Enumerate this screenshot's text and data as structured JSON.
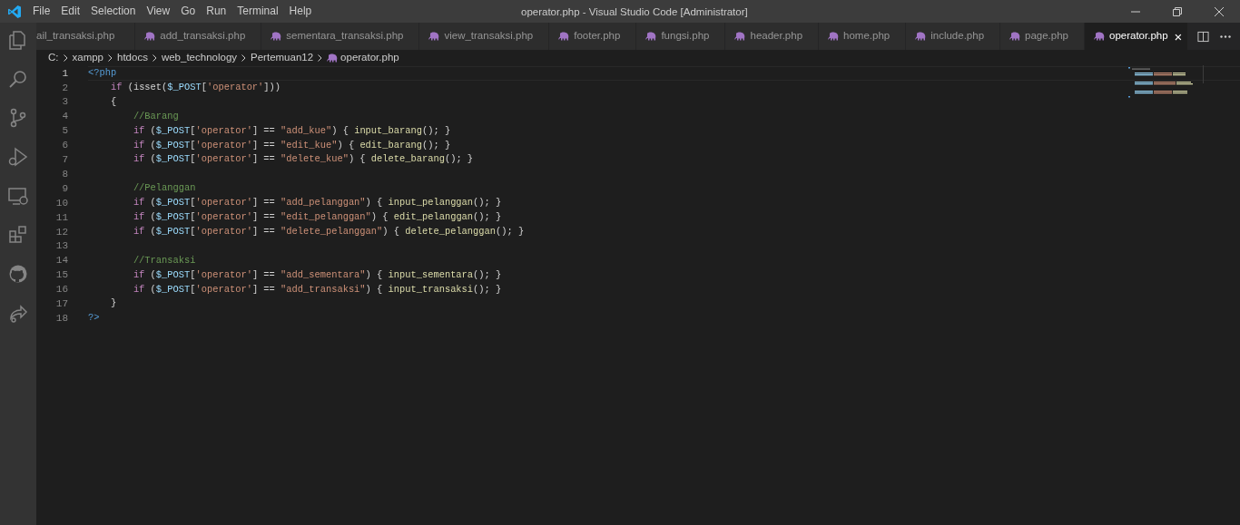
{
  "menu": [
    "File",
    "Edit",
    "Selection",
    "View",
    "Go",
    "Run",
    "Terminal",
    "Help"
  ],
  "window": {
    "title": "operator.php - Visual Studio Code [Administrator]"
  },
  "activity_bar": [
    {
      "kind": "explorer",
      "selected": false
    },
    {
      "kind": "search",
      "selected": false
    },
    {
      "kind": "scm",
      "selected": false
    },
    {
      "kind": "debug",
      "selected": false
    },
    {
      "kind": "remote",
      "selected": false
    },
    {
      "kind": "extensions",
      "selected": false
    },
    {
      "kind": "github",
      "selected": false
    },
    {
      "kind": "share",
      "selected": false
    }
  ],
  "tabs": [
    {
      "label": "ail_transaksi.php",
      "icon": false,
      "selected": false
    },
    {
      "label": "add_transaksi.php",
      "icon": true,
      "selected": false
    },
    {
      "label": "sementara_transaksi.php",
      "icon": true,
      "selected": false
    },
    {
      "label": "view_transaksi.php",
      "icon": true,
      "selected": false
    },
    {
      "label": "footer.php",
      "icon": true,
      "selected": false
    },
    {
      "label": "fungsi.php",
      "icon": true,
      "selected": false
    },
    {
      "label": "header.php",
      "icon": true,
      "selected": false
    },
    {
      "label": "home.php",
      "icon": true,
      "selected": false
    },
    {
      "label": "include.php",
      "icon": true,
      "selected": false
    },
    {
      "label": "page.php",
      "icon": true,
      "selected": false
    },
    {
      "label": "operator.php",
      "icon": true,
      "selected": true,
      "close": "×"
    }
  ],
  "breadcrumb": [
    "C:",
    "xampp",
    "htdocs",
    "web_technology",
    "Pertemuan12",
    "operator.php"
  ],
  "editor": {
    "lines": [
      {
        "number": "1",
        "selected": true,
        "tokens": [
          {
            "kind": "tag",
            "text": "<?php"
          }
        ],
        "children": [
          {
            "number": "2",
            "selected": false,
            "tokens": [
              {
                "kind": "kw",
                "text": "if"
              },
              {
                "kind": "punc",
                "text": " (isset("
              },
              {
                "kind": "var",
                "text": "$_POST"
              },
              {
                "kind": "punc",
                "text": "["
              },
              {
                "kind": "str",
                "text": "'operator'"
              },
              {
                "kind": "punc",
                "text": "]))"
              }
            ]
          },
          {
            "number": "3",
            "selected": false,
            "tokens": [
              {
                "kind": "punc",
                "text": "{"
              }
            ],
            "children": [
              {
                "number": "4",
                "selected": false,
                "tokens": [
                  {
                    "kind": "cmt",
                    "text": "//Barang"
                  }
                ]
              },
              {
                "number": "5",
                "selected": false,
                "tokens": [
                  {
                    "kind": "kw",
                    "text": "if"
                  },
                  {
                    "kind": "punc",
                    "text": " ("
                  },
                  {
                    "kind": "var",
                    "text": "$_POST"
                  },
                  {
                    "kind": "punc",
                    "text": "["
                  },
                  {
                    "kind": "str",
                    "text": "'operator'"
                  },
                  {
                    "kind": "punc",
                    "text": "] == "
                  },
                  {
                    "kind": "str",
                    "text": "\"add_kue\""
                  },
                  {
                    "kind": "punc",
                    "text": ") { "
                  },
                  {
                    "kind": "fn",
                    "text": "input_barang"
                  },
                  {
                    "kind": "punc",
                    "text": "(); }"
                  }
                ]
              },
              {
                "number": "6",
                "selected": false,
                "tokens": [
                  {
                    "kind": "kw",
                    "text": "if"
                  },
                  {
                    "kind": "punc",
                    "text": " ("
                  },
                  {
                    "kind": "var",
                    "text": "$_POST"
                  },
                  {
                    "kind": "punc",
                    "text": "["
                  },
                  {
                    "kind": "str",
                    "text": "'operator'"
                  },
                  {
                    "kind": "punc",
                    "text": "] == "
                  },
                  {
                    "kind": "str",
                    "text": "\"edit_kue\""
                  },
                  {
                    "kind": "punc",
                    "text": ") { "
                  },
                  {
                    "kind": "fn",
                    "text": "edit_barang"
                  },
                  {
                    "kind": "punc",
                    "text": "(); }"
                  }
                ]
              },
              {
                "number": "7",
                "selected": false,
                "tokens": [
                  {
                    "kind": "kw",
                    "text": "if"
                  },
                  {
                    "kind": "punc",
                    "text": " ("
                  },
                  {
                    "kind": "var",
                    "text": "$_POST"
                  },
                  {
                    "kind": "punc",
                    "text": "["
                  },
                  {
                    "kind": "str",
                    "text": "'operator'"
                  },
                  {
                    "kind": "punc",
                    "text": "] == "
                  },
                  {
                    "kind": "str",
                    "text": "\"delete_kue\""
                  },
                  {
                    "kind": "punc",
                    "text": ") { "
                  },
                  {
                    "kind": "fn",
                    "text": "delete_barang"
                  },
                  {
                    "kind": "punc",
                    "text": "(); }"
                  }
                ]
              },
              {
                "number": "8",
                "selected": false
              },
              {
                "number": "9",
                "selected": false,
                "tokens": [
                  {
                    "kind": "cmt",
                    "text": "//Pelanggan"
                  }
                ]
              },
              {
                "number": "10",
                "selected": false,
                "tokens": [
                  {
                    "kind": "kw",
                    "text": "if"
                  },
                  {
                    "kind": "punc",
                    "text": " ("
                  },
                  {
                    "kind": "var",
                    "text": "$_POST"
                  },
                  {
                    "kind": "punc",
                    "text": "["
                  },
                  {
                    "kind": "str",
                    "text": "'operator'"
                  },
                  {
                    "kind": "punc",
                    "text": "] == "
                  },
                  {
                    "kind": "str",
                    "text": "\"add_pelanggan\""
                  },
                  {
                    "kind": "punc",
                    "text": ") { "
                  },
                  {
                    "kind": "fn",
                    "text": "input_pelanggan"
                  },
                  {
                    "kind": "punc",
                    "text": "(); }"
                  }
                ]
              },
              {
                "number": "11",
                "selected": false,
                "tokens": [
                  {
                    "kind": "kw",
                    "text": "if"
                  },
                  {
                    "kind": "punc",
                    "text": " ("
                  },
                  {
                    "kind": "var",
                    "text": "$_POST"
                  },
                  {
                    "kind": "punc",
                    "text": "["
                  },
                  {
                    "kind": "str",
                    "text": "'operator'"
                  },
                  {
                    "kind": "punc",
                    "text": "] == "
                  },
                  {
                    "kind": "str",
                    "text": "\"edit_pelanggan\""
                  },
                  {
                    "kind": "punc",
                    "text": ") { "
                  },
                  {
                    "kind": "fn",
                    "text": "edit_pelanggan"
                  },
                  {
                    "kind": "punc",
                    "text": "(); }"
                  }
                ]
              },
              {
                "number": "12",
                "selected": false,
                "tokens": [
                  {
                    "kind": "kw",
                    "text": "if"
                  },
                  {
                    "kind": "punc",
                    "text": " ("
                  },
                  {
                    "kind": "var",
                    "text": "$_POST"
                  },
                  {
                    "kind": "punc",
                    "text": "["
                  },
                  {
                    "kind": "str",
                    "text": "'operator'"
                  },
                  {
                    "kind": "punc",
                    "text": "] == "
                  },
                  {
                    "kind": "str",
                    "text": "\"delete_pelanggan\""
                  },
                  {
                    "kind": "punc",
                    "text": ") { "
                  },
                  {
                    "kind": "fn",
                    "text": "delete_pelanggan"
                  },
                  {
                    "kind": "punc",
                    "text": "(); }"
                  }
                ]
              },
              {
                "number": "13",
                "selected": false
              },
              {
                "number": "14",
                "selected": false,
                "tokens": [
                  {
                    "kind": "cmt",
                    "text": "//Transaksi"
                  }
                ]
              },
              {
                "number": "15",
                "selected": false,
                "tokens": [
                  {
                    "kind": "kw",
                    "text": "if"
                  },
                  {
                    "kind": "punc",
                    "text": " ("
                  },
                  {
                    "kind": "var",
                    "text": "$_POST"
                  },
                  {
                    "kind": "punc",
                    "text": "["
                  },
                  {
                    "kind": "str",
                    "text": "'operator'"
                  },
                  {
                    "kind": "punc",
                    "text": "] == "
                  },
                  {
                    "kind": "str",
                    "text": "\"add_sementara\""
                  },
                  {
                    "kind": "punc",
                    "text": ") { "
                  },
                  {
                    "kind": "fn",
                    "text": "input_sementara"
                  },
                  {
                    "kind": "punc",
                    "text": "(); }"
                  }
                ]
              },
              {
                "number": "16",
                "selected": false,
                "tokens": [
                  {
                    "kind": "kw",
                    "text": "if"
                  },
                  {
                    "kind": "punc",
                    "text": " ("
                  },
                  {
                    "kind": "var",
                    "text": "$_POST"
                  },
                  {
                    "kind": "punc",
                    "text": "["
                  },
                  {
                    "kind": "str",
                    "text": "'operator'"
                  },
                  {
                    "kind": "punc",
                    "text": "] == "
                  },
                  {
                    "kind": "str",
                    "text": "\"add_transaksi\""
                  },
                  {
                    "kind": "punc",
                    "text": ") { "
                  },
                  {
                    "kind": "fn",
                    "text": "input_transaksi"
                  },
                  {
                    "kind": "punc",
                    "text": "(); }"
                  }
                ]
              }
            ]
          },
          {
            "number": "17",
            "selected": false,
            "tokens": [
              {
                "kind": "punc",
                "text": "}"
              }
            ]
          }
        ]
      },
      {
        "number": "18",
        "selected": false,
        "tokens": [
          {
            "kind": "tag",
            "text": "?>"
          }
        ]
      }
    ]
  }
}
